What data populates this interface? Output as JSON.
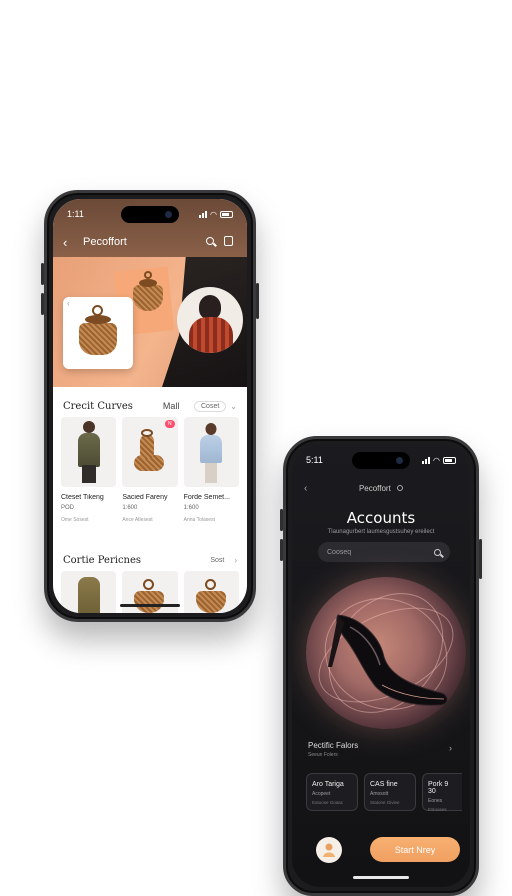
{
  "phone1": {
    "status": {
      "time": "1:11"
    },
    "nav": {
      "title": "Pecoffort"
    },
    "section1": {
      "title": "Crecit Curves",
      "mid": "Mall",
      "pill": "Coset"
    },
    "products": [
      {
        "name": "Cteset Tikeng",
        "price": "POD",
        "sub": "Ome Sosest",
        "badge": ""
      },
      {
        "name": "Sacied Fareny",
        "price": "1:600",
        "sub": "Ance Atlesest",
        "badge": "N"
      },
      {
        "name": "Forde Semet...",
        "price": "1:600",
        "sub": "Anna Tolasest",
        "badge": ""
      }
    ],
    "section2": {
      "title": "Cortie Pericnes",
      "pill": "Sost"
    }
  },
  "phone2": {
    "status": {
      "time": "5:11"
    },
    "nav": {
      "title": "Pecoffort"
    },
    "title": "Accounts",
    "subtitle": "Tlaunagurbert laumesgustsuhey ereilect",
    "search": {
      "placeholder": "Cooseq"
    },
    "row": {
      "title": "Pectific Falors",
      "sub": "Seeun Folers"
    },
    "cards": [
      {
        "title": "Aro Tariga",
        "sub": "Acopeet",
        "meta": "Eatoose Goaac"
      },
      {
        "title": "CAS fine",
        "sub": "Amosott",
        "meta": "Statone Giviee"
      },
      {
        "title": "Pork 9 30",
        "sub": "Eones",
        "meta": "Estooses"
      }
    ],
    "cta": "Start Nrey"
  }
}
